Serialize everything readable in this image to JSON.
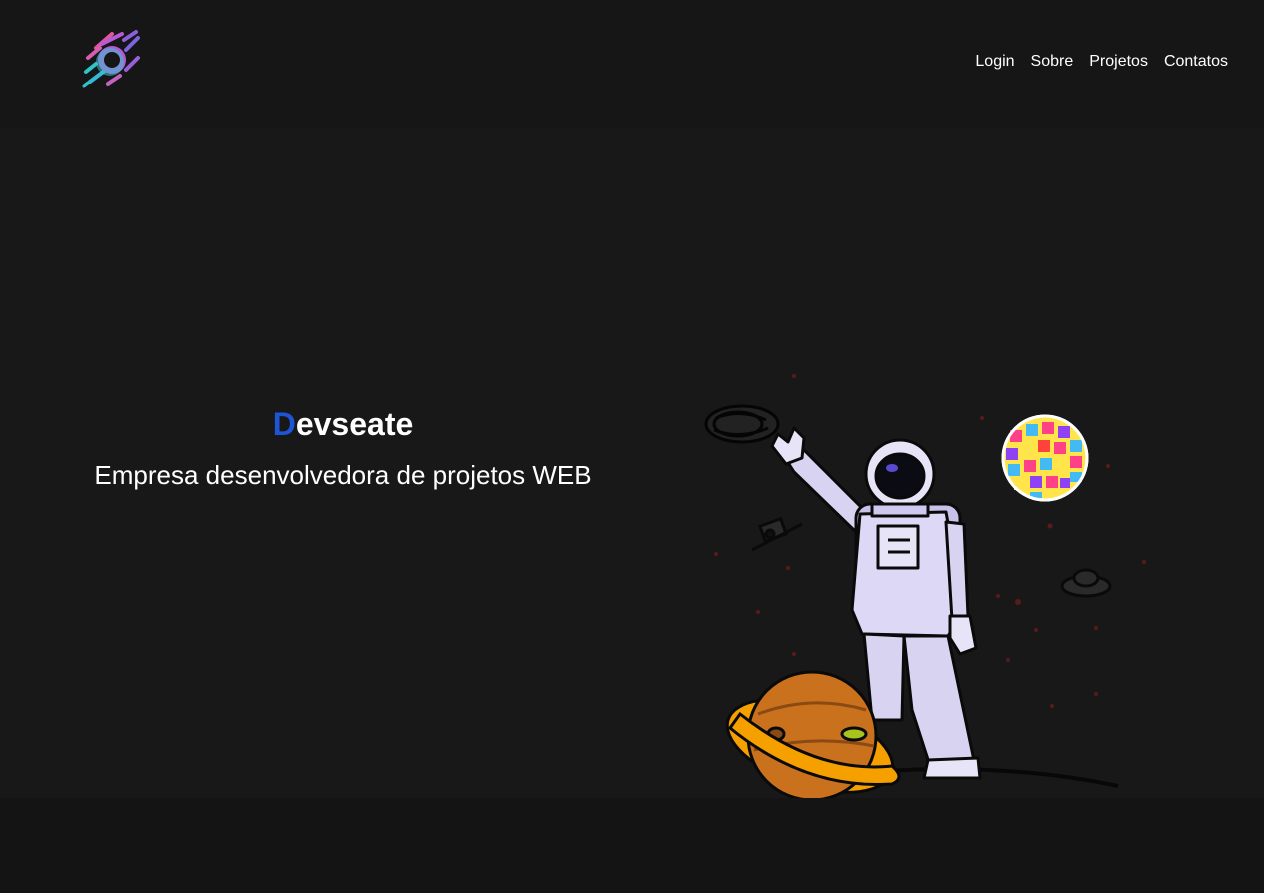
{
  "header": {
    "logo_icon": "comet-logo-icon",
    "nav": [
      {
        "label": "Login"
      },
      {
        "label": "Sobre"
      },
      {
        "label": "Projetos"
      },
      {
        "label": "Contatos"
      }
    ]
  },
  "hero": {
    "brand_initial": "D",
    "brand_rest": "evseate",
    "tagline": "Empresa desenvolvedora de projetos WEB",
    "illustration": "astronaut-space-illustration"
  },
  "colors": {
    "background": "#181818",
    "header_bg": "#161616",
    "accent": "#1e54d6",
    "text": "#ffffff"
  }
}
